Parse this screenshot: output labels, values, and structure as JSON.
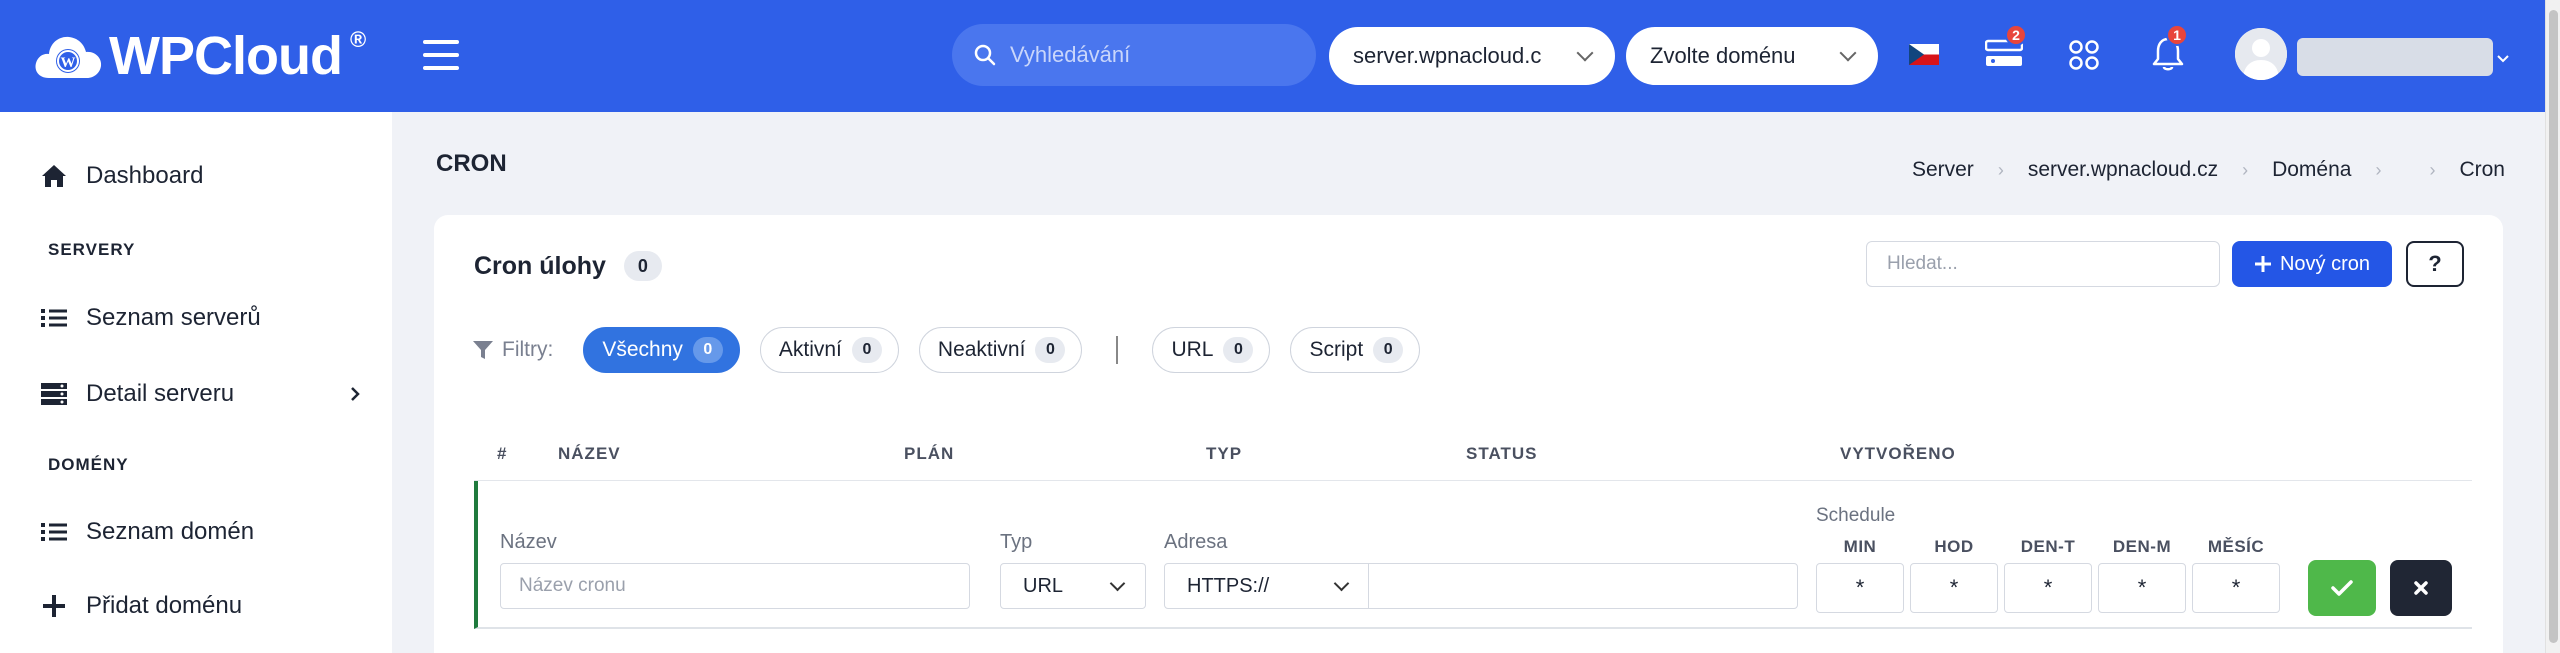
{
  "header": {
    "logo_text": "WPCloud",
    "logo_mark": "®",
    "search_placeholder": "Vyhledávání",
    "server_select": "server.wpnacloud.c",
    "domain_select": "Zvolte doménu",
    "flag_icon": "czech-flag-icon",
    "server_badge": "2",
    "notif_badge": "1",
    "brand_color": "#2f5fe8"
  },
  "sidebar": {
    "items": [
      {
        "label": "Dashboard",
        "icon": "home-icon"
      },
      {
        "label": "Seznam serverů",
        "icon": "list-icon"
      },
      {
        "label": "Detail serveru",
        "icon": "server-icon"
      },
      {
        "label": "Seznam domén",
        "icon": "list-icon"
      },
      {
        "label": "Přidat doménu",
        "icon": "plus-icon"
      }
    ],
    "sections": [
      "SERVERY",
      "DOMÉNY"
    ]
  },
  "page": {
    "title": "CRON",
    "breadcrumb": [
      "Server",
      "server.wpnacloud.cz",
      "Doména",
      "",
      "Cron"
    ]
  },
  "card": {
    "title": "Cron úlohy",
    "count": "0",
    "search_placeholder": "Hledat...",
    "new_button": "Nový cron",
    "help_button": "?"
  },
  "filters": {
    "label": "Filtry:",
    "chips": [
      {
        "label": "Všechny",
        "count": "0",
        "active": true
      },
      {
        "label": "Aktivní",
        "count": "0"
      },
      {
        "label": "Neaktivní",
        "count": "0"
      },
      {
        "label": "URL",
        "count": "0"
      },
      {
        "label": "Script",
        "count": "0"
      }
    ]
  },
  "table": {
    "columns": [
      "#",
      "NÁZEV",
      "PLÁN",
      "TYP",
      "STATUS",
      "VYTVOŘENO"
    ]
  },
  "form": {
    "name_label": "Název",
    "name_placeholder": "Název cronu",
    "type_label": "Typ",
    "type_value": "URL",
    "address_label": "Adresa",
    "protocol_value": "HTTPS://",
    "address_value": "",
    "schedule_label": "Schedule",
    "schedule": [
      {
        "label": "MIN",
        "value": "*"
      },
      {
        "label": "HOD",
        "value": "*"
      },
      {
        "label": "DEN-T",
        "value": "*"
      },
      {
        "label": "DEN-M",
        "value": "*"
      },
      {
        "label": "MĚSÍC",
        "value": "*"
      }
    ],
    "ok_color": "#4fb84a",
    "cancel_color": "#202634"
  }
}
